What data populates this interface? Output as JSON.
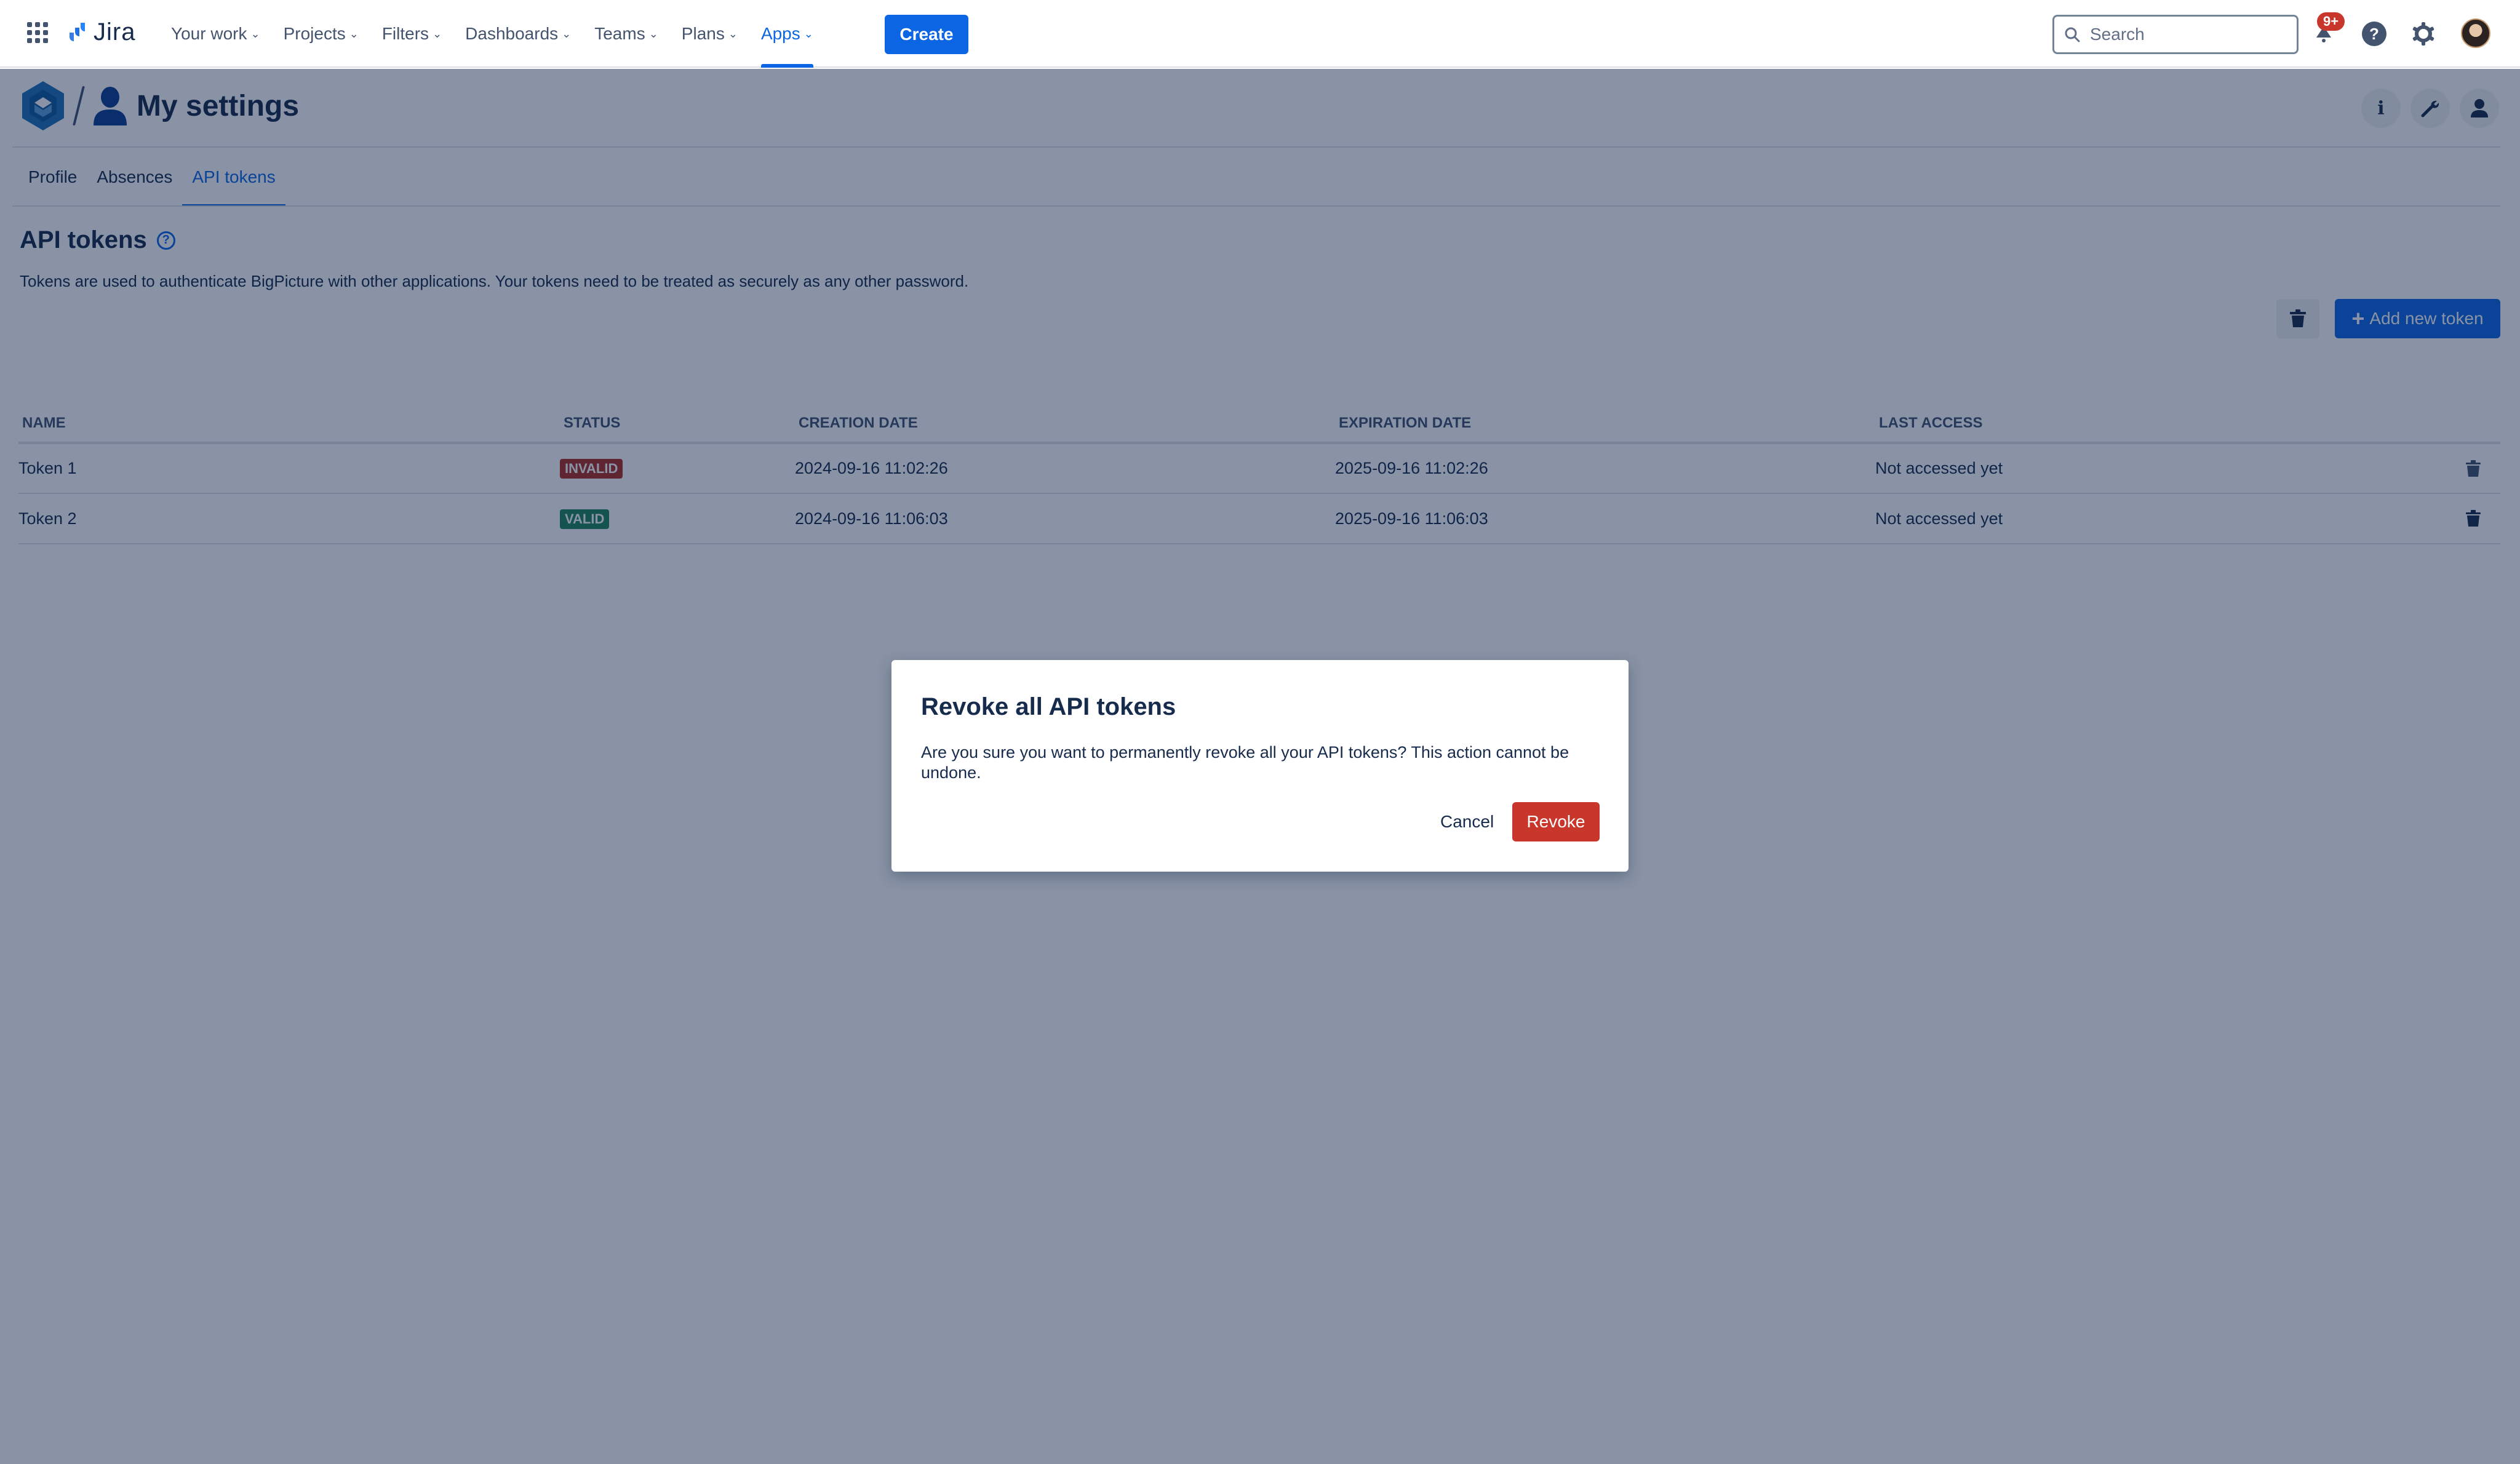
{
  "topnav": {
    "product_name": "Jira",
    "items": [
      {
        "label": "Your work",
        "active": false
      },
      {
        "label": "Projects",
        "active": false
      },
      {
        "label": "Filters",
        "active": false
      },
      {
        "label": "Dashboards",
        "active": false
      },
      {
        "label": "Teams",
        "active": false
      },
      {
        "label": "Plans",
        "active": false
      },
      {
        "label": "Apps",
        "active": true
      }
    ],
    "create_label": "Create",
    "search_placeholder": "Search",
    "notifications_badge": "9+",
    "icons": [
      "app-switcher-icon",
      "jira-logo-icon",
      "search-icon",
      "bell-icon",
      "help-icon",
      "gear-icon",
      "avatar"
    ]
  },
  "page": {
    "title": "My settings",
    "tabs": [
      {
        "label": "Profile",
        "active": false
      },
      {
        "label": "Absences",
        "active": false
      },
      {
        "label": "API tokens",
        "active": true
      }
    ],
    "header_actions": [
      "info-icon",
      "wrench-icon",
      "user-icon"
    ],
    "section": {
      "title": "API tokens",
      "description": "Tokens are used to authenticate BigPicture with other applications. Your tokens need to be treated as securely as any other password.",
      "add_button_label": "Add new token"
    },
    "table": {
      "columns": [
        "NAME",
        "STATUS",
        "CREATION DATE",
        "EXPIRATION DATE",
        "LAST ACCESS"
      ],
      "rows": [
        {
          "name": "Token 1",
          "status": "INVALID",
          "created": "2024-09-16 11:02:26",
          "expires": "2025-09-16 11:02:26",
          "last_access": "Not accessed yet"
        },
        {
          "name": "Token 2",
          "status": "VALID",
          "created": "2024-09-16 11:06:03",
          "expires": "2025-09-16 11:06:03",
          "last_access": "Not accessed yet"
        }
      ]
    }
  },
  "modal": {
    "title": "Revoke all API tokens",
    "body": "Are you sure you want to permanently revoke all your API tokens? This action cannot be undone.",
    "cancel_label": "Cancel",
    "confirm_label": "Revoke"
  },
  "colors": {
    "brand_blue": "#0c66e4",
    "danger": "#c9372c",
    "status_invalid": "#ae2e24",
    "status_valid": "#1f845a",
    "overlay": "rgba(9,30,66,0.48)"
  }
}
